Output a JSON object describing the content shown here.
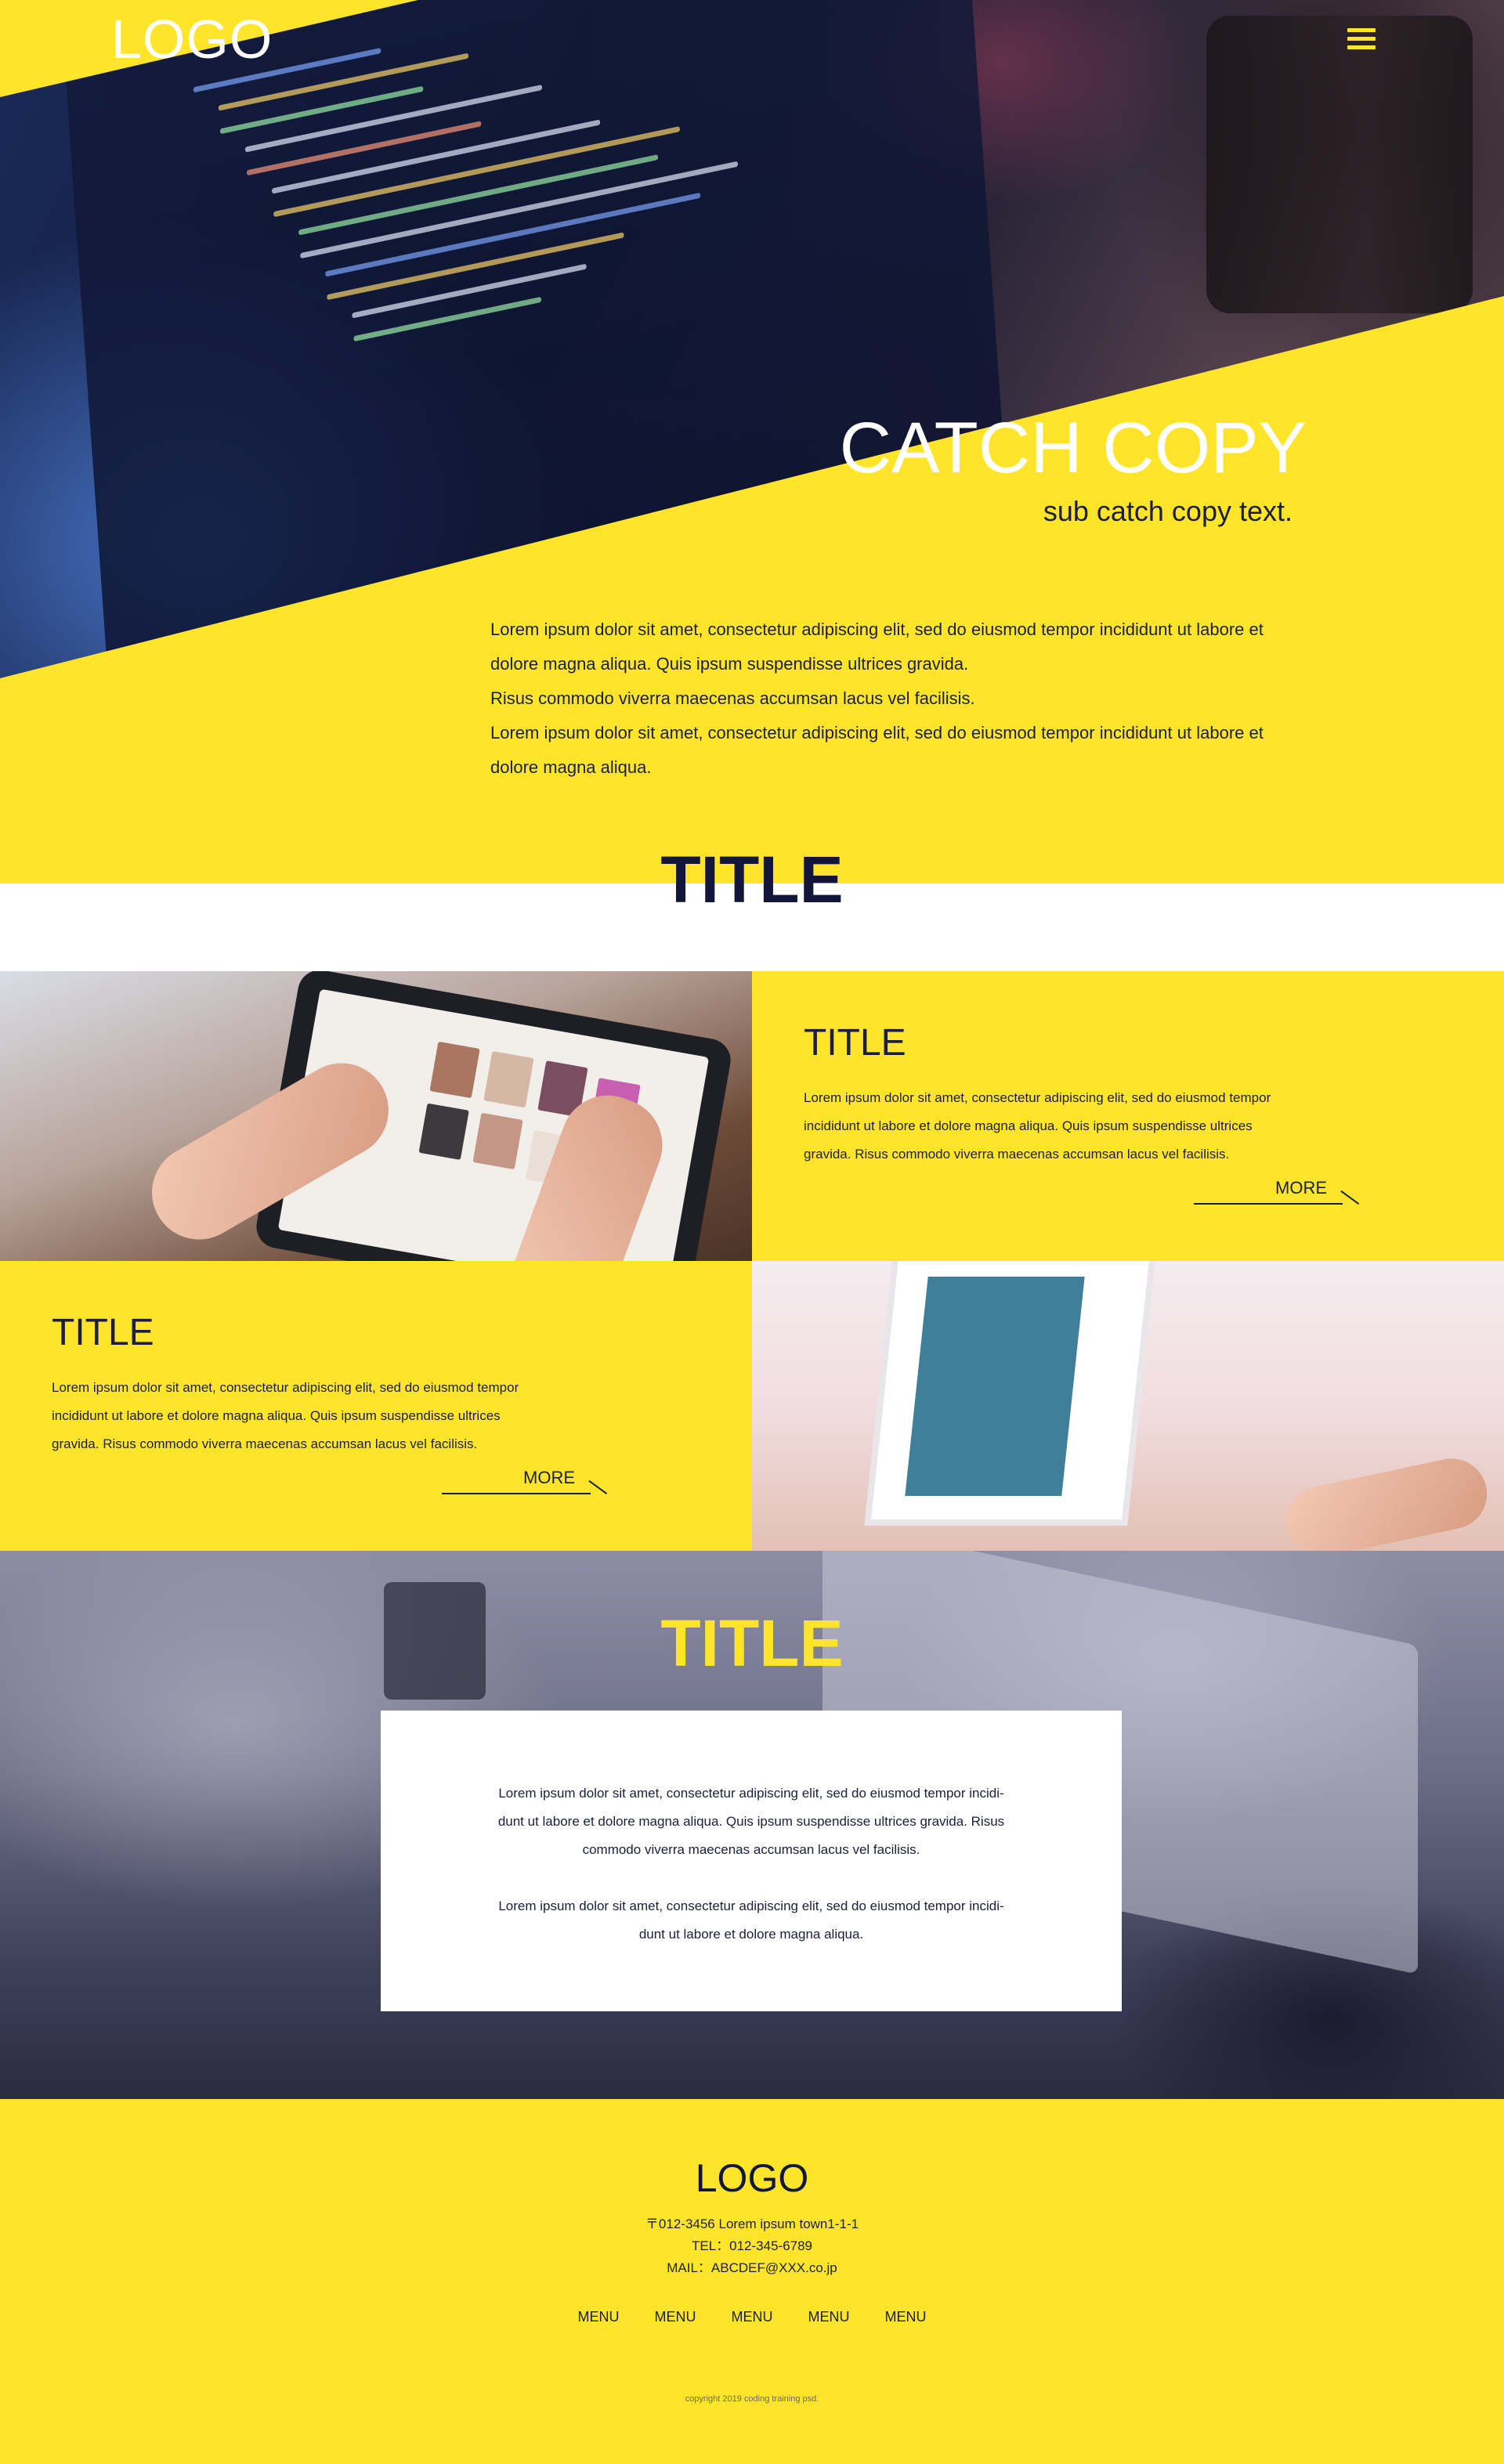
{
  "header": {
    "logo": "LOGO",
    "menu_icon": "hamburger-menu-icon"
  },
  "hero": {
    "catch_copy": "CATCH COPY",
    "sub_catch": "sub catch copy text.",
    "paragraphs": [
      "Lorem ipsum dolor sit amet, consectetur adipiscing elit, sed do eiusmod tempor incididunt ut labore et",
      "dolore magna aliqua. Quis ipsum suspendisse ultrices gravida.",
      "Risus commodo viverra maecenas accumsan lacus vel facilisis.",
      "Lorem ipsum dolor sit amet, consectetur adipiscing elit, sed do eiusmod tempor incididunt ut labore et",
      "dolore magna aliqua."
    ]
  },
  "section_title": "TITLE",
  "features": [
    {
      "title": "TITLE",
      "lines": [
        "Lorem ipsum dolor sit amet, consectetur adipiscing elit, sed do eiusmod tempor",
        "incididunt ut labore et dolore magna aliqua. Quis ipsum suspendisse ultrices",
        "gravida. Risus commodo viverra maecenas accumsan lacus vel facilisis."
      ],
      "more": "MORE"
    },
    {
      "title": "TITLE",
      "lines": [
        "Lorem ipsum dolor sit amet, consectetur adipiscing elit, sed do eiusmod tempor",
        "incididunt ut labore et dolore magna aliqua. Quis ipsum suspendisse ultrices",
        "gravida. Risus commodo viverra maecenas accumsan lacus vel facilisis."
      ],
      "more": "MORE"
    }
  ],
  "dark_section": {
    "title": "TITLE",
    "lines_1": [
      "Lorem ipsum dolor sit amet, consectetur adipiscing elit, sed do eiusmod tempor incidi-",
      "dunt ut labore et dolore magna aliqua. Quis ipsum suspendisse ultrices gravida. Risus",
      "commodo viverra maecenas accumsan lacus vel facilisis."
    ],
    "lines_2": [
      "Lorem ipsum dolor sit amet, consectetur adipiscing elit, sed do eiusmod tempor incidi-",
      "dunt ut labore et dolore magna aliqua."
    ]
  },
  "footer": {
    "logo": "LOGO",
    "address": "〒012-3456 Lorem ipsum town1-1-1",
    "tel": "TEL：012-345-6789",
    "mail": "MAIL：ABCDEF@XXX.co.jp",
    "menu": [
      "MENU",
      "MENU",
      "MENU",
      "MENU",
      "MENU"
    ],
    "copyright": "copyright 2019 coding training psd."
  },
  "colors": {
    "accent": "#ffe52a",
    "navy": "#1c1f3b",
    "white": "#ffffff"
  }
}
